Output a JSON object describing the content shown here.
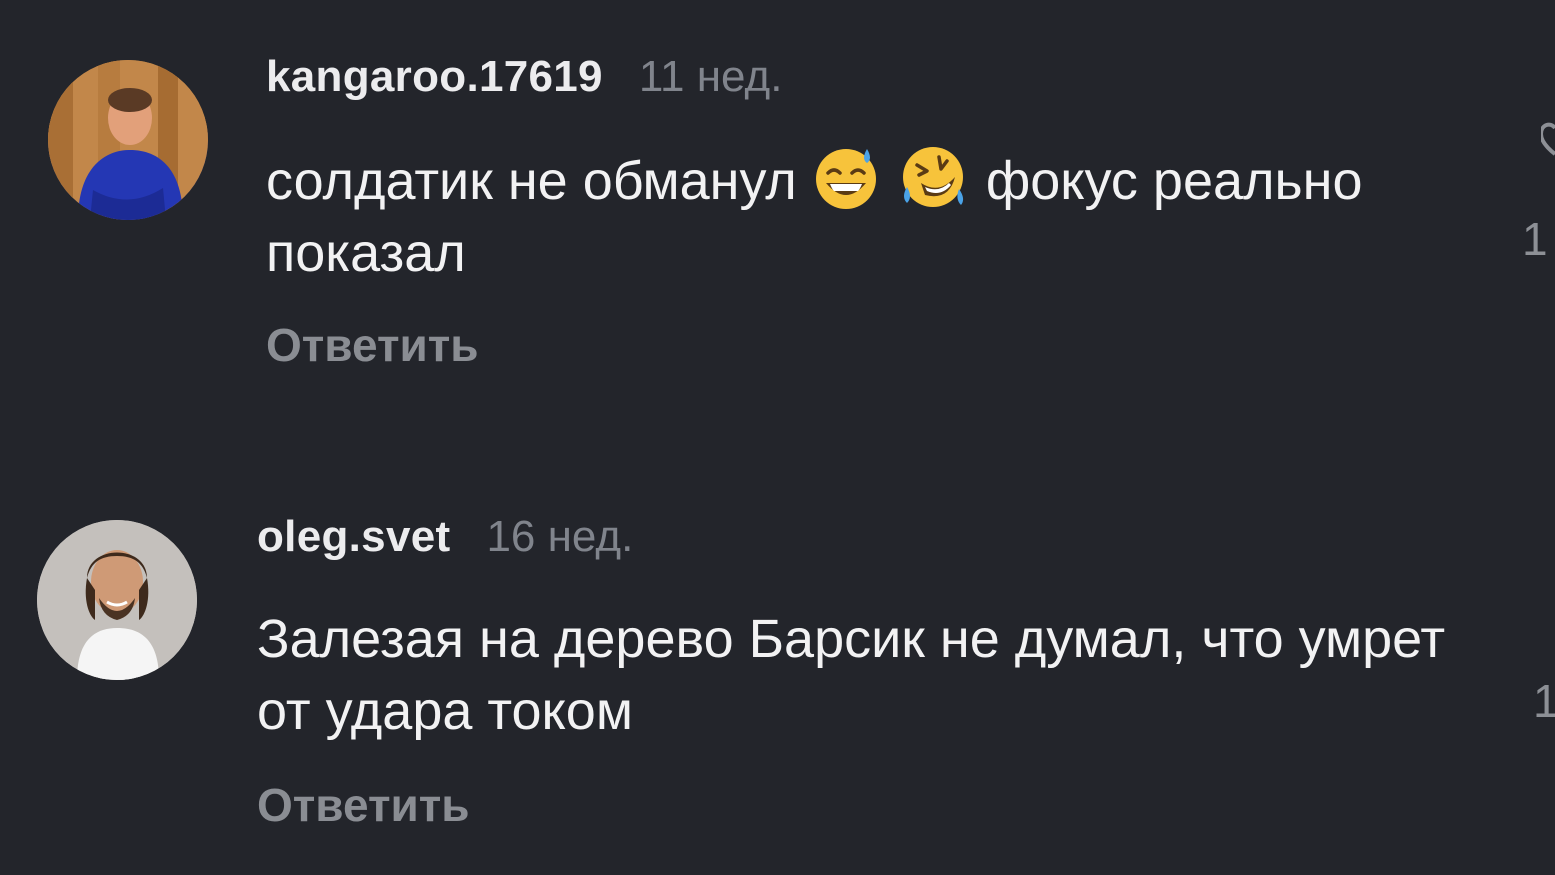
{
  "comments": [
    {
      "username": "kangaroo.17619",
      "time": "11 нед.",
      "text_part1": "солдатик не обманул",
      "emojis": [
        "grinning-sweat-emoji",
        "rolling-on-floor-laughing-emoji"
      ],
      "text_part2": "фокус реально показал",
      "reply_label": "Ответить",
      "like_count": "1"
    },
    {
      "username": "oleg.svet",
      "time": "16 нед.",
      "text": "Залезая на дерево Барсик не думал, что умрет от удара током",
      "reply_label": "Ответить",
      "like_count": "1"
    }
  ],
  "colors": {
    "background": "#23252b",
    "username": "#ececee",
    "muted": "#80848c",
    "text": "#f2f2f3",
    "reply": "#8a8d93"
  }
}
